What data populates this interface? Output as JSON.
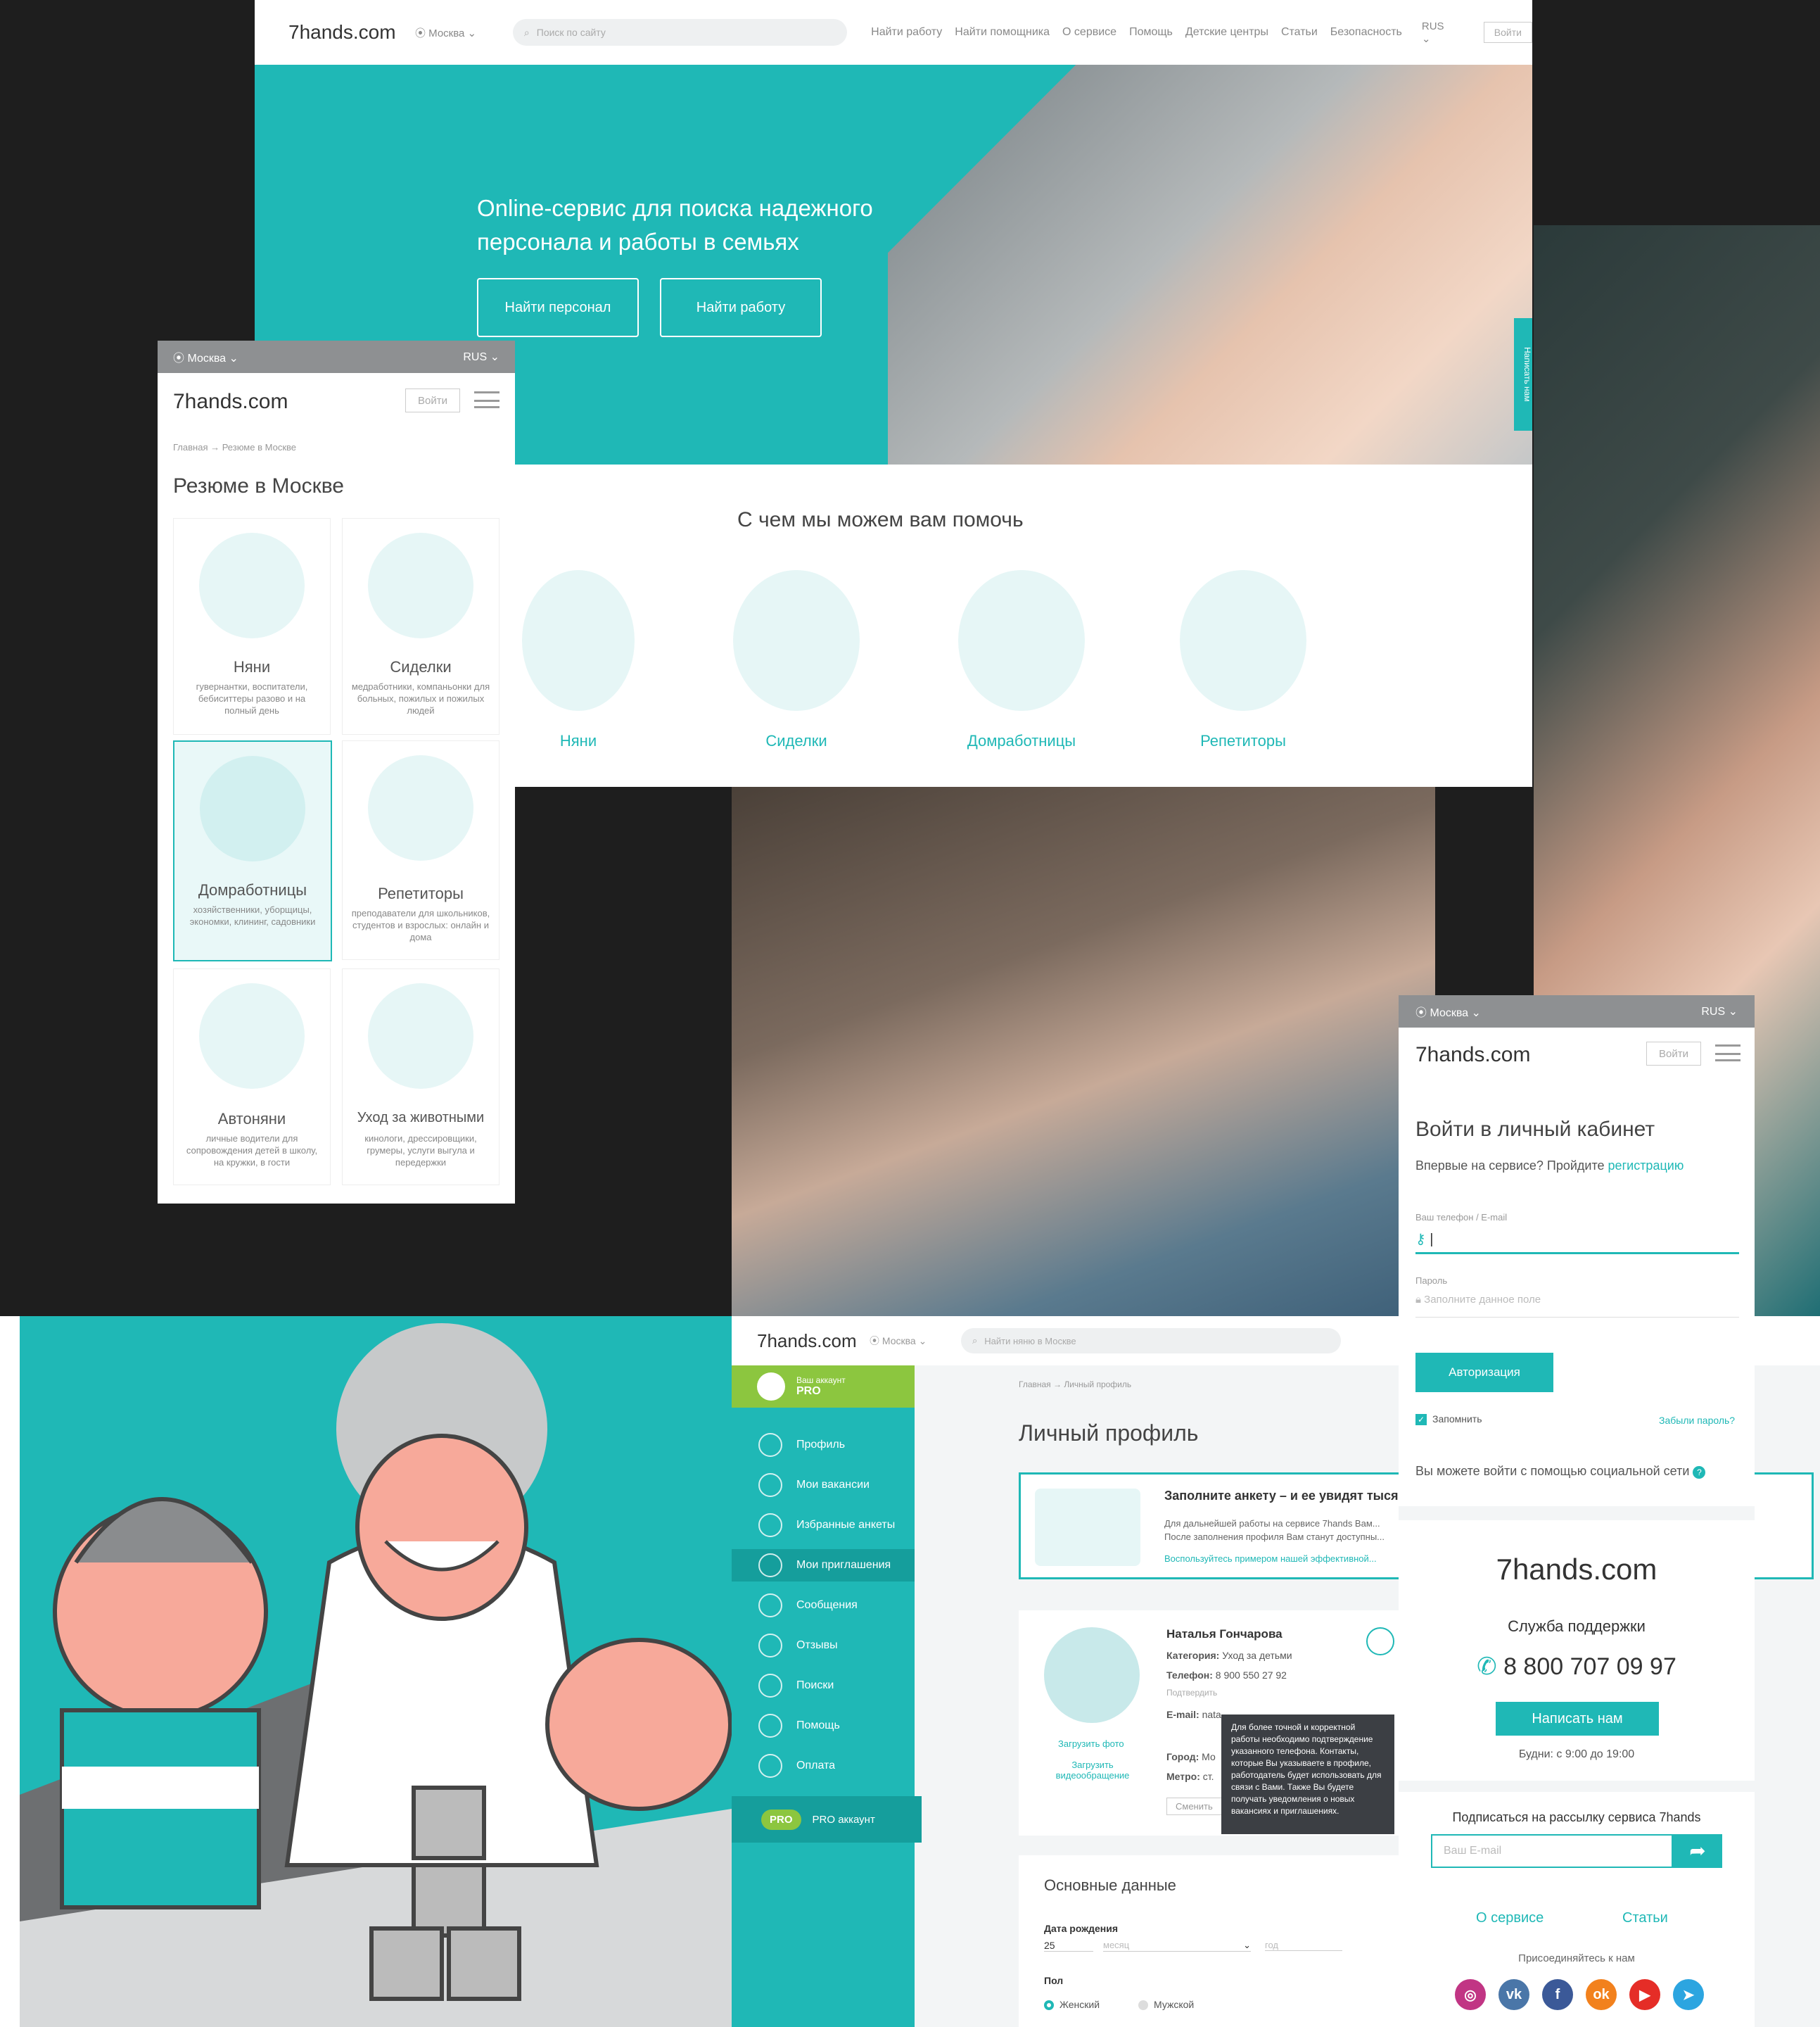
{
  "desktop": {
    "logo": "7hands.com",
    "city": "Москва",
    "search_placeholder": "Поиск по сайту",
    "nav": [
      "Найти работу",
      "Найти помощника",
      "О сервисе",
      "Помощь",
      "Детские центры",
      "Статьи",
      "Безопасность"
    ],
    "lang": "RUS",
    "login": "Войти",
    "hero_title": "Online-сервис для поиска надежного персонала и работы в семьях",
    "btn_find_staff": "Найти персонал",
    "btn_find_job": "Найти работу",
    "write_us": "Написать нам",
    "help_title": "С чем мы можем вам помочь",
    "services": [
      "Няни",
      "Сиделки",
      "Домработницы",
      "Репетиторы"
    ]
  },
  "mobile_resume": {
    "city": "Москва",
    "lang": "RUS",
    "logo": "7hands.com",
    "login": "Войти",
    "breadcrumb": "Главная → Резюме в Москве",
    "title": "Резюме в Москве",
    "cards": [
      {
        "title": "Няни",
        "desc": "гувернантки, воспитатели, бебиситтеры разово и на полный день"
      },
      {
        "title": "Сиделки",
        "desc": "медработники, компаньонки для больных, пожилых и пожилых людей"
      },
      {
        "title": "Домработницы",
        "desc": "хозяйственники, уборщицы, экономки, клининг, садовники"
      },
      {
        "title": "Репетиторы",
        "desc": "преподаватели для школьников, студентов и взрослых: онлайн и дома"
      },
      {
        "title": "Автоняни",
        "desc": "личные водители для сопровождения детей в школу, на кружки, в гости"
      },
      {
        "title": "Уход за животными",
        "desc": "кинологи, дрессировщики, грумеры, услуги выгула и передержки"
      }
    ]
  },
  "mobile_login": {
    "city": "Москва",
    "lang": "RUS",
    "logo": "7hands.com",
    "login": "Войти",
    "title": "Войти в личный кабинет",
    "first_time": "Впервые на сервисе? Пройдите",
    "register_link": "регистрацию",
    "phone_label": "Ваш телефон / E-mail",
    "password_label": "Пароль",
    "password_placeholder": "Заполните данное поле",
    "auth_button": "Авторизация",
    "remember": "Запомнить",
    "forgot": "Забыли пароль?",
    "social_login": "Вы можете войти с помощью социальной сети",
    "support_title": "Служба поддержки",
    "phone": "8 800 707 09 97",
    "write_us": "Написать нам",
    "hours": "Будни: с 9:00 до 19:00",
    "subscribe": "Подписаться на рассылку сервиса 7hands",
    "email_placeholder": "Ваш E-mail",
    "footer_links": [
      "О сервисе",
      "Статьи"
    ],
    "join": "Присоединяйтесь к нам",
    "socials": [
      "instagram-icon",
      "vk-icon",
      "facebook-icon",
      "odnoklassniki-icon",
      "youtube-icon",
      "telegram-icon"
    ]
  },
  "profile": {
    "logo": "7hands.com",
    "city": "Москва",
    "search_placeholder": "Найти няню в Москве",
    "account_label": "Ваш аккаунт",
    "account_type": "PRO",
    "menu": [
      "Профиль",
      "Мои вакансии",
      "Избранные анкеты",
      "Мои приглашения",
      "Сообщения",
      "Отзывы",
      "Поиски",
      "Помощь",
      "Оплата"
    ],
    "pro_badge": "PRO",
    "pro_account": "PRO аккаунт",
    "breadcrumb": "Главная → Личный профиль",
    "title": "Личный профиль",
    "fill_title": "Заполните анкету – и ее увидят тысячи",
    "fill_text": "Для дальнейшей работы на сервисе 7hands Вам... После заполнения профиля Вам станут доступны...",
    "fill_link": "Воспользуйтесь примером нашей эффективной...",
    "name": "Наталья Гончарова",
    "category_label": "Категория:",
    "category": "Уход за детьми",
    "phone_label": "Телефон:",
    "phone": "8 900 550 27 92",
    "confirm": "Подтвердить",
    "email_label": "E-mail:",
    "email": "nata",
    "city_label": "Город:",
    "city_value": "Мо",
    "metro_label": "Метро:",
    "metro": "ст.",
    "upload_photo": "Загрузить фото",
    "upload_video": "Загрузить видеообращение",
    "change": "Сменить",
    "tooltip": "Для более точной и корректной работы необходимо подтверждение указанного телефона. Контакты, которые Вы указываете в профиле, работодатель будет использовать для связи с Вами. Также Вы будете получать уведомления о новых вакансиях и приглашениях.",
    "basic_data": "Основные данные",
    "birth_label": "Дата рождения",
    "birth_day": "25",
    "birth_month": "месяц",
    "birth_year": "год",
    "gender_label": "Пол",
    "gender_female": "Женский",
    "gender_male": "Мужской"
  },
  "colors": {
    "teal": "#1fb8b6",
    "green": "#8cc63f",
    "dark": "#1e1e1e"
  }
}
